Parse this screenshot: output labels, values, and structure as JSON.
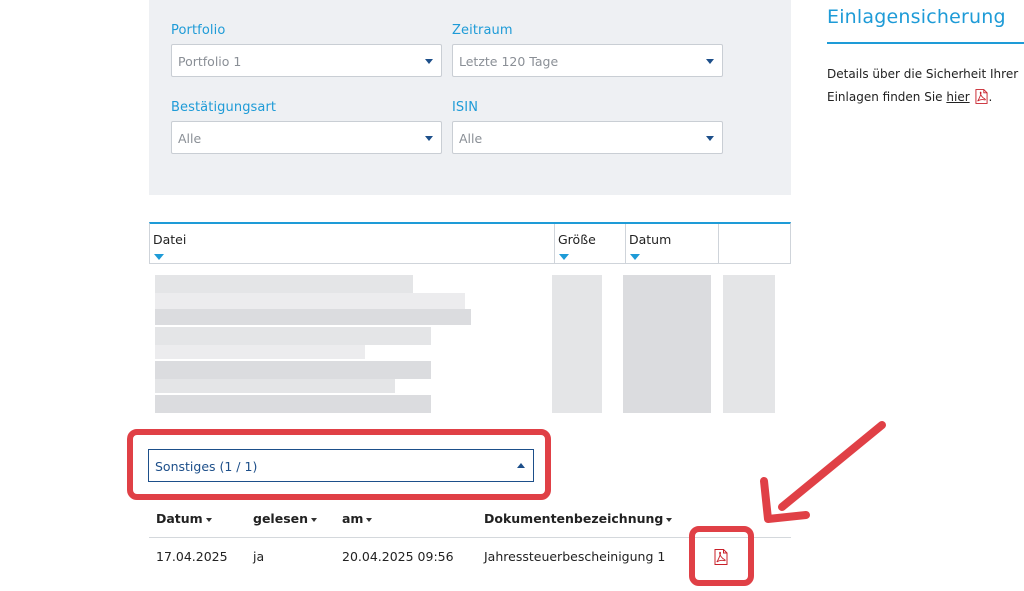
{
  "filters": {
    "portfolio_label": "Portfolio",
    "portfolio_value": "Portfolio 1",
    "zeitraum_label": "Zeitraum",
    "zeitraum_value": "Letzte 120 Tage",
    "bestaetigungsart_label": "Bestätigungsart",
    "bestaetigungsart_value": "Alle",
    "isin_label": "ISIN",
    "isin_value": "Alle"
  },
  "files_table": {
    "columns": [
      "Datei",
      "Größe",
      "Datum"
    ]
  },
  "section": {
    "label": "Sonstiges  (1 / 1)"
  },
  "documents": {
    "headers": [
      "Datum",
      "gelesen",
      "am",
      "Dokumentenbezeichnung"
    ],
    "rows": [
      {
        "datum": "17.04.2025",
        "gelesen": "ja",
        "am": "20.04.2025 09:56",
        "bezeichnung": "Jahressteuerbescheinigung 1",
        "icon": "pdf-icon"
      }
    ]
  },
  "sidebar": {
    "title": "Einlagensicherung",
    "text_line1": "Details über die Sicherheit Ihrer",
    "text_line2_prefix": "Einlagen finden Sie ",
    "link": "hier",
    "text_line2_suffix": "."
  },
  "colors": {
    "accent": "#1e9bd7",
    "dark_blue": "#1d4f8a",
    "annotation_red": "#e04046",
    "pdf_red": "#c8202a",
    "panel_bg": "#eef0f3"
  }
}
